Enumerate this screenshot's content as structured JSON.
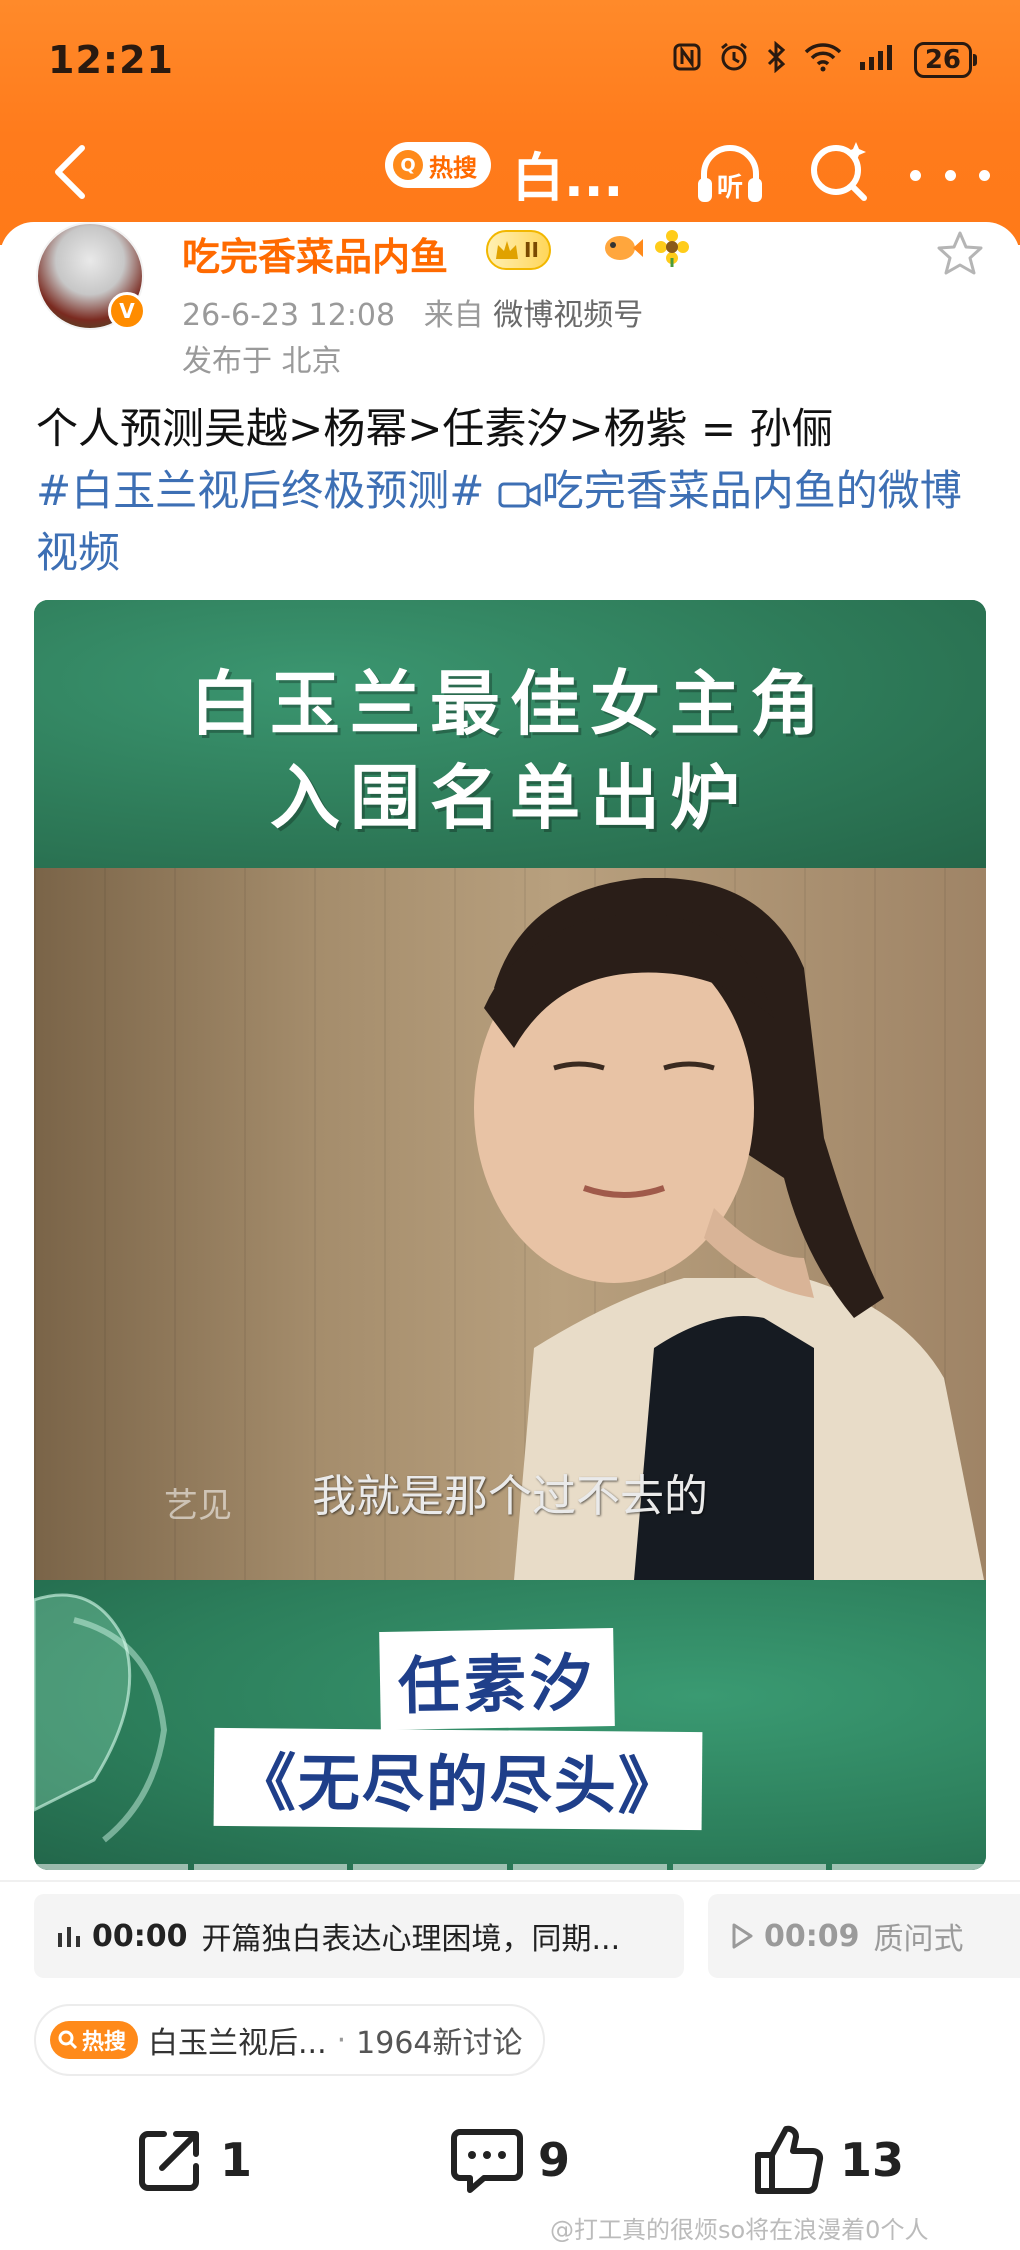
{
  "status_bar": {
    "time": "12:21",
    "icons": [
      "nfc-icon",
      "alarm-icon",
      "bluetooth-icon",
      "wifi-icon",
      "signal-icon"
    ],
    "battery": "26"
  },
  "nav": {
    "hot_search_label": "热搜",
    "title": "白...",
    "listen_label": "听"
  },
  "post": {
    "username": "吃完香菜品内鱼",
    "level_badge": "II",
    "timestamp": "26-6-23 12:08",
    "source_prefix": "来自",
    "source": "微博视频号",
    "location": "发布于 北京",
    "text": "个人预测吴越>杨幂>任素汐>杨紫 = 孙俪",
    "topic": "#白玉兰视后终极预测#",
    "video_link": "吃完香菜品内鱼的微博视频"
  },
  "video": {
    "title_line1": "白玉兰最佳女主角",
    "title_line2": "入围名单出炉",
    "subtitle": "我就是那个过不去的",
    "watermark": "艺见",
    "actress_name": "任素汐",
    "work_title": "《无尽的尽头》"
  },
  "chapters": [
    {
      "time": "00:00",
      "text": "开篇独白表达心理困境，同期..."
    },
    {
      "time": "00:09",
      "text": "质问式"
    }
  ],
  "hot_tag": {
    "label": "热搜",
    "topic": "白玉兰视后...",
    "separator": "·",
    "discussions": "1964新讨论"
  },
  "actions": {
    "share_count": "1",
    "comment_count": "9",
    "like_count": "13"
  },
  "footer_watermark": "@打工真的很烦so将在浪漫着0个人",
  "colors": {
    "header_orange": "#ff7b1c",
    "username_orange": "#ff6a00",
    "link_blue": "#3d6fb4",
    "video_green": "#2e7b59"
  }
}
